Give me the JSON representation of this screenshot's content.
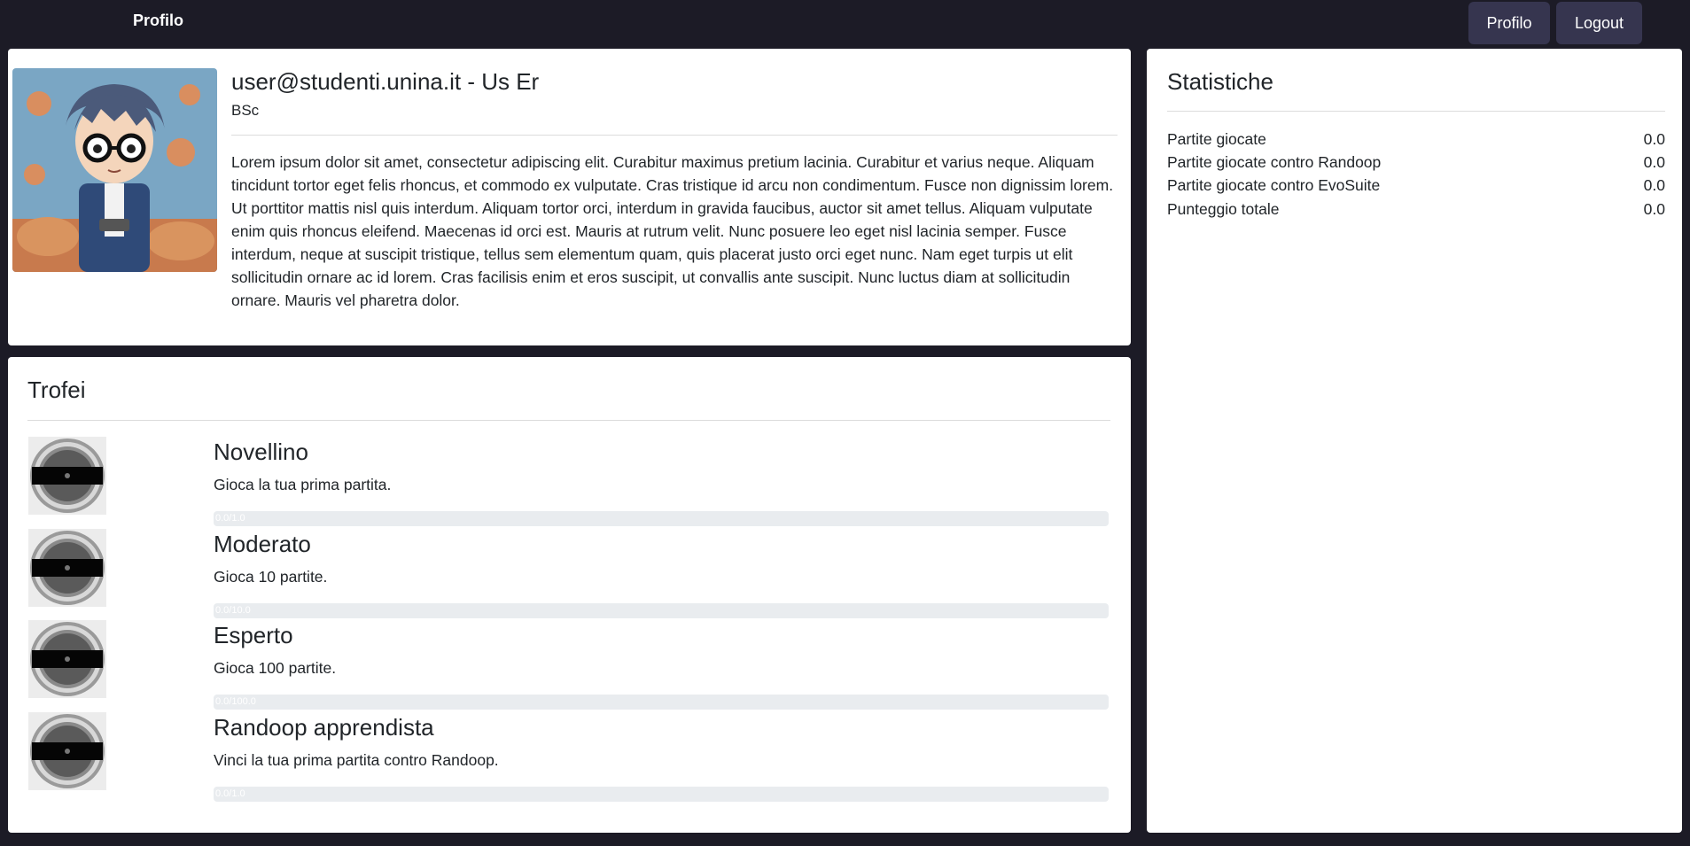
{
  "nav": {
    "brand": "Profilo",
    "profile_button": "Profilo",
    "logout_button": "Logout"
  },
  "profile": {
    "title": "user@studenti.unina.it - Us Er",
    "degree": "BSc",
    "bio": "Lorem ipsum dolor sit amet, consectetur adipiscing elit. Curabitur maximus pretium lacinia. Curabitur et varius neque. Aliquam tincidunt tortor eget felis rhoncus, et commodo ex vulputate. Cras tristique id arcu non condimentum. Fusce non dignissim lorem. Ut porttitor mattis nisl quis interdum. Aliquam tortor orci, interdum in gravida faucibus, auctor sit amet tellus. Aliquam vulputate enim quis rhoncus eleifend. Maecenas id orci est. Mauris at rutrum velit. Nunc posuere leo eget nisl lacinia semper. Fusce interdum, neque at suscipit tristique, tellus sem elementum quam, quis placerat justo orci eget nunc. Nam eget turpis ut elit sollicitudin ornare ac id lorem. Cras facilisis enim et eros suscipit, ut convallis ante suscipit. Nunc luctus diam at sollicitudin ornare. Mauris vel pharetra dolor."
  },
  "trophies": {
    "title": "Trofei",
    "items": [
      {
        "name": "Novellino",
        "description": "Gioca la tua prima partita.",
        "progress_label": "0.0/1.0",
        "progress_fraction": 0.0
      },
      {
        "name": "Moderato",
        "description": "Gioca 10 partite.",
        "progress_label": "0.0/10.0",
        "progress_fraction": 0.0
      },
      {
        "name": "Esperto",
        "description": "Gioca 100 partite.",
        "progress_label": "0.0/100.0",
        "progress_fraction": 0.0
      },
      {
        "name": "Randoop apprendista",
        "description": "Vinci la tua prima partita contro Randoop.",
        "progress_label": "0.0/1.0",
        "progress_fraction": 0.0
      }
    ]
  },
  "stats": {
    "title": "Statistiche",
    "rows": [
      {
        "label": "Partite giocate",
        "value": "0.0"
      },
      {
        "label": "Partite giocate contro Randoop",
        "value": "0.0"
      },
      {
        "label": "Partite giocate contro EvoSuite",
        "value": "0.0"
      },
      {
        "label": "Punteggio totale",
        "value": "0.0"
      }
    ]
  },
  "colors": {
    "background": "#1c1b26",
    "nav_button": "#36354f",
    "progress_track": "#e9ecef"
  }
}
